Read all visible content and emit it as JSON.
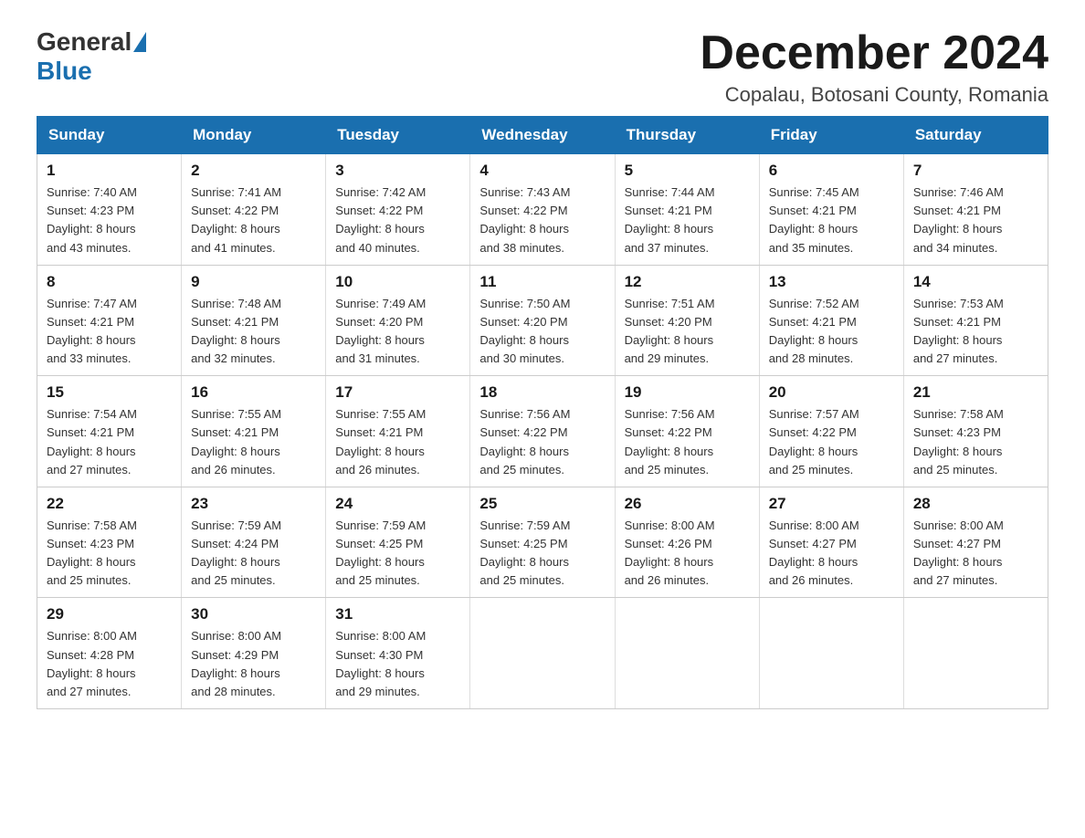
{
  "header": {
    "logo": {
      "general": "General",
      "blue": "Blue"
    },
    "title": "December 2024",
    "subtitle": "Copalau, Botosani County, Romania"
  },
  "days_of_week": [
    "Sunday",
    "Monday",
    "Tuesday",
    "Wednesday",
    "Thursday",
    "Friday",
    "Saturday"
  ],
  "weeks": [
    [
      {
        "day": "1",
        "sunrise": "7:40 AM",
        "sunset": "4:23 PM",
        "daylight_h": "8",
        "daylight_m": "43"
      },
      {
        "day": "2",
        "sunrise": "7:41 AM",
        "sunset": "4:22 PM",
        "daylight_h": "8",
        "daylight_m": "41"
      },
      {
        "day": "3",
        "sunrise": "7:42 AM",
        "sunset": "4:22 PM",
        "daylight_h": "8",
        "daylight_m": "40"
      },
      {
        "day": "4",
        "sunrise": "7:43 AM",
        "sunset": "4:22 PM",
        "daylight_h": "8",
        "daylight_m": "38"
      },
      {
        "day": "5",
        "sunrise": "7:44 AM",
        "sunset": "4:21 PM",
        "daylight_h": "8",
        "daylight_m": "37"
      },
      {
        "day": "6",
        "sunrise": "7:45 AM",
        "sunset": "4:21 PM",
        "daylight_h": "8",
        "daylight_m": "35"
      },
      {
        "day": "7",
        "sunrise": "7:46 AM",
        "sunset": "4:21 PM",
        "daylight_h": "8",
        "daylight_m": "34"
      }
    ],
    [
      {
        "day": "8",
        "sunrise": "7:47 AM",
        "sunset": "4:21 PM",
        "daylight_h": "8",
        "daylight_m": "33"
      },
      {
        "day": "9",
        "sunrise": "7:48 AM",
        "sunset": "4:21 PM",
        "daylight_h": "8",
        "daylight_m": "32"
      },
      {
        "day": "10",
        "sunrise": "7:49 AM",
        "sunset": "4:20 PM",
        "daylight_h": "8",
        "daylight_m": "31"
      },
      {
        "day": "11",
        "sunrise": "7:50 AM",
        "sunset": "4:20 PM",
        "daylight_h": "8",
        "daylight_m": "30"
      },
      {
        "day": "12",
        "sunrise": "7:51 AM",
        "sunset": "4:20 PM",
        "daylight_h": "8",
        "daylight_m": "29"
      },
      {
        "day": "13",
        "sunrise": "7:52 AM",
        "sunset": "4:21 PM",
        "daylight_h": "8",
        "daylight_m": "28"
      },
      {
        "day": "14",
        "sunrise": "7:53 AM",
        "sunset": "4:21 PM",
        "daylight_h": "8",
        "daylight_m": "27"
      }
    ],
    [
      {
        "day": "15",
        "sunrise": "7:54 AM",
        "sunset": "4:21 PM",
        "daylight_h": "8",
        "daylight_m": "27"
      },
      {
        "day": "16",
        "sunrise": "7:55 AM",
        "sunset": "4:21 PM",
        "daylight_h": "8",
        "daylight_m": "26"
      },
      {
        "day": "17",
        "sunrise": "7:55 AM",
        "sunset": "4:21 PM",
        "daylight_h": "8",
        "daylight_m": "26"
      },
      {
        "day": "18",
        "sunrise": "7:56 AM",
        "sunset": "4:22 PM",
        "daylight_h": "8",
        "daylight_m": "25"
      },
      {
        "day": "19",
        "sunrise": "7:56 AM",
        "sunset": "4:22 PM",
        "daylight_h": "8",
        "daylight_m": "25"
      },
      {
        "day": "20",
        "sunrise": "7:57 AM",
        "sunset": "4:22 PM",
        "daylight_h": "8",
        "daylight_m": "25"
      },
      {
        "day": "21",
        "sunrise": "7:58 AM",
        "sunset": "4:23 PM",
        "daylight_h": "8",
        "daylight_m": "25"
      }
    ],
    [
      {
        "day": "22",
        "sunrise": "7:58 AM",
        "sunset": "4:23 PM",
        "daylight_h": "8",
        "daylight_m": "25"
      },
      {
        "day": "23",
        "sunrise": "7:59 AM",
        "sunset": "4:24 PM",
        "daylight_h": "8",
        "daylight_m": "25"
      },
      {
        "day": "24",
        "sunrise": "7:59 AM",
        "sunset": "4:25 PM",
        "daylight_h": "8",
        "daylight_m": "25"
      },
      {
        "day": "25",
        "sunrise": "7:59 AM",
        "sunset": "4:25 PM",
        "daylight_h": "8",
        "daylight_m": "25"
      },
      {
        "day": "26",
        "sunrise": "8:00 AM",
        "sunset": "4:26 PM",
        "daylight_h": "8",
        "daylight_m": "26"
      },
      {
        "day": "27",
        "sunrise": "8:00 AM",
        "sunset": "4:27 PM",
        "daylight_h": "8",
        "daylight_m": "26"
      },
      {
        "day": "28",
        "sunrise": "8:00 AM",
        "sunset": "4:27 PM",
        "daylight_h": "8",
        "daylight_m": "27"
      }
    ],
    [
      {
        "day": "29",
        "sunrise": "8:00 AM",
        "sunset": "4:28 PM",
        "daylight_h": "8",
        "daylight_m": "27"
      },
      {
        "day": "30",
        "sunrise": "8:00 AM",
        "sunset": "4:29 PM",
        "daylight_h": "8",
        "daylight_m": "28"
      },
      {
        "day": "31",
        "sunrise": "8:00 AM",
        "sunset": "4:30 PM",
        "daylight_h": "8",
        "daylight_m": "29"
      },
      null,
      null,
      null,
      null
    ]
  ]
}
